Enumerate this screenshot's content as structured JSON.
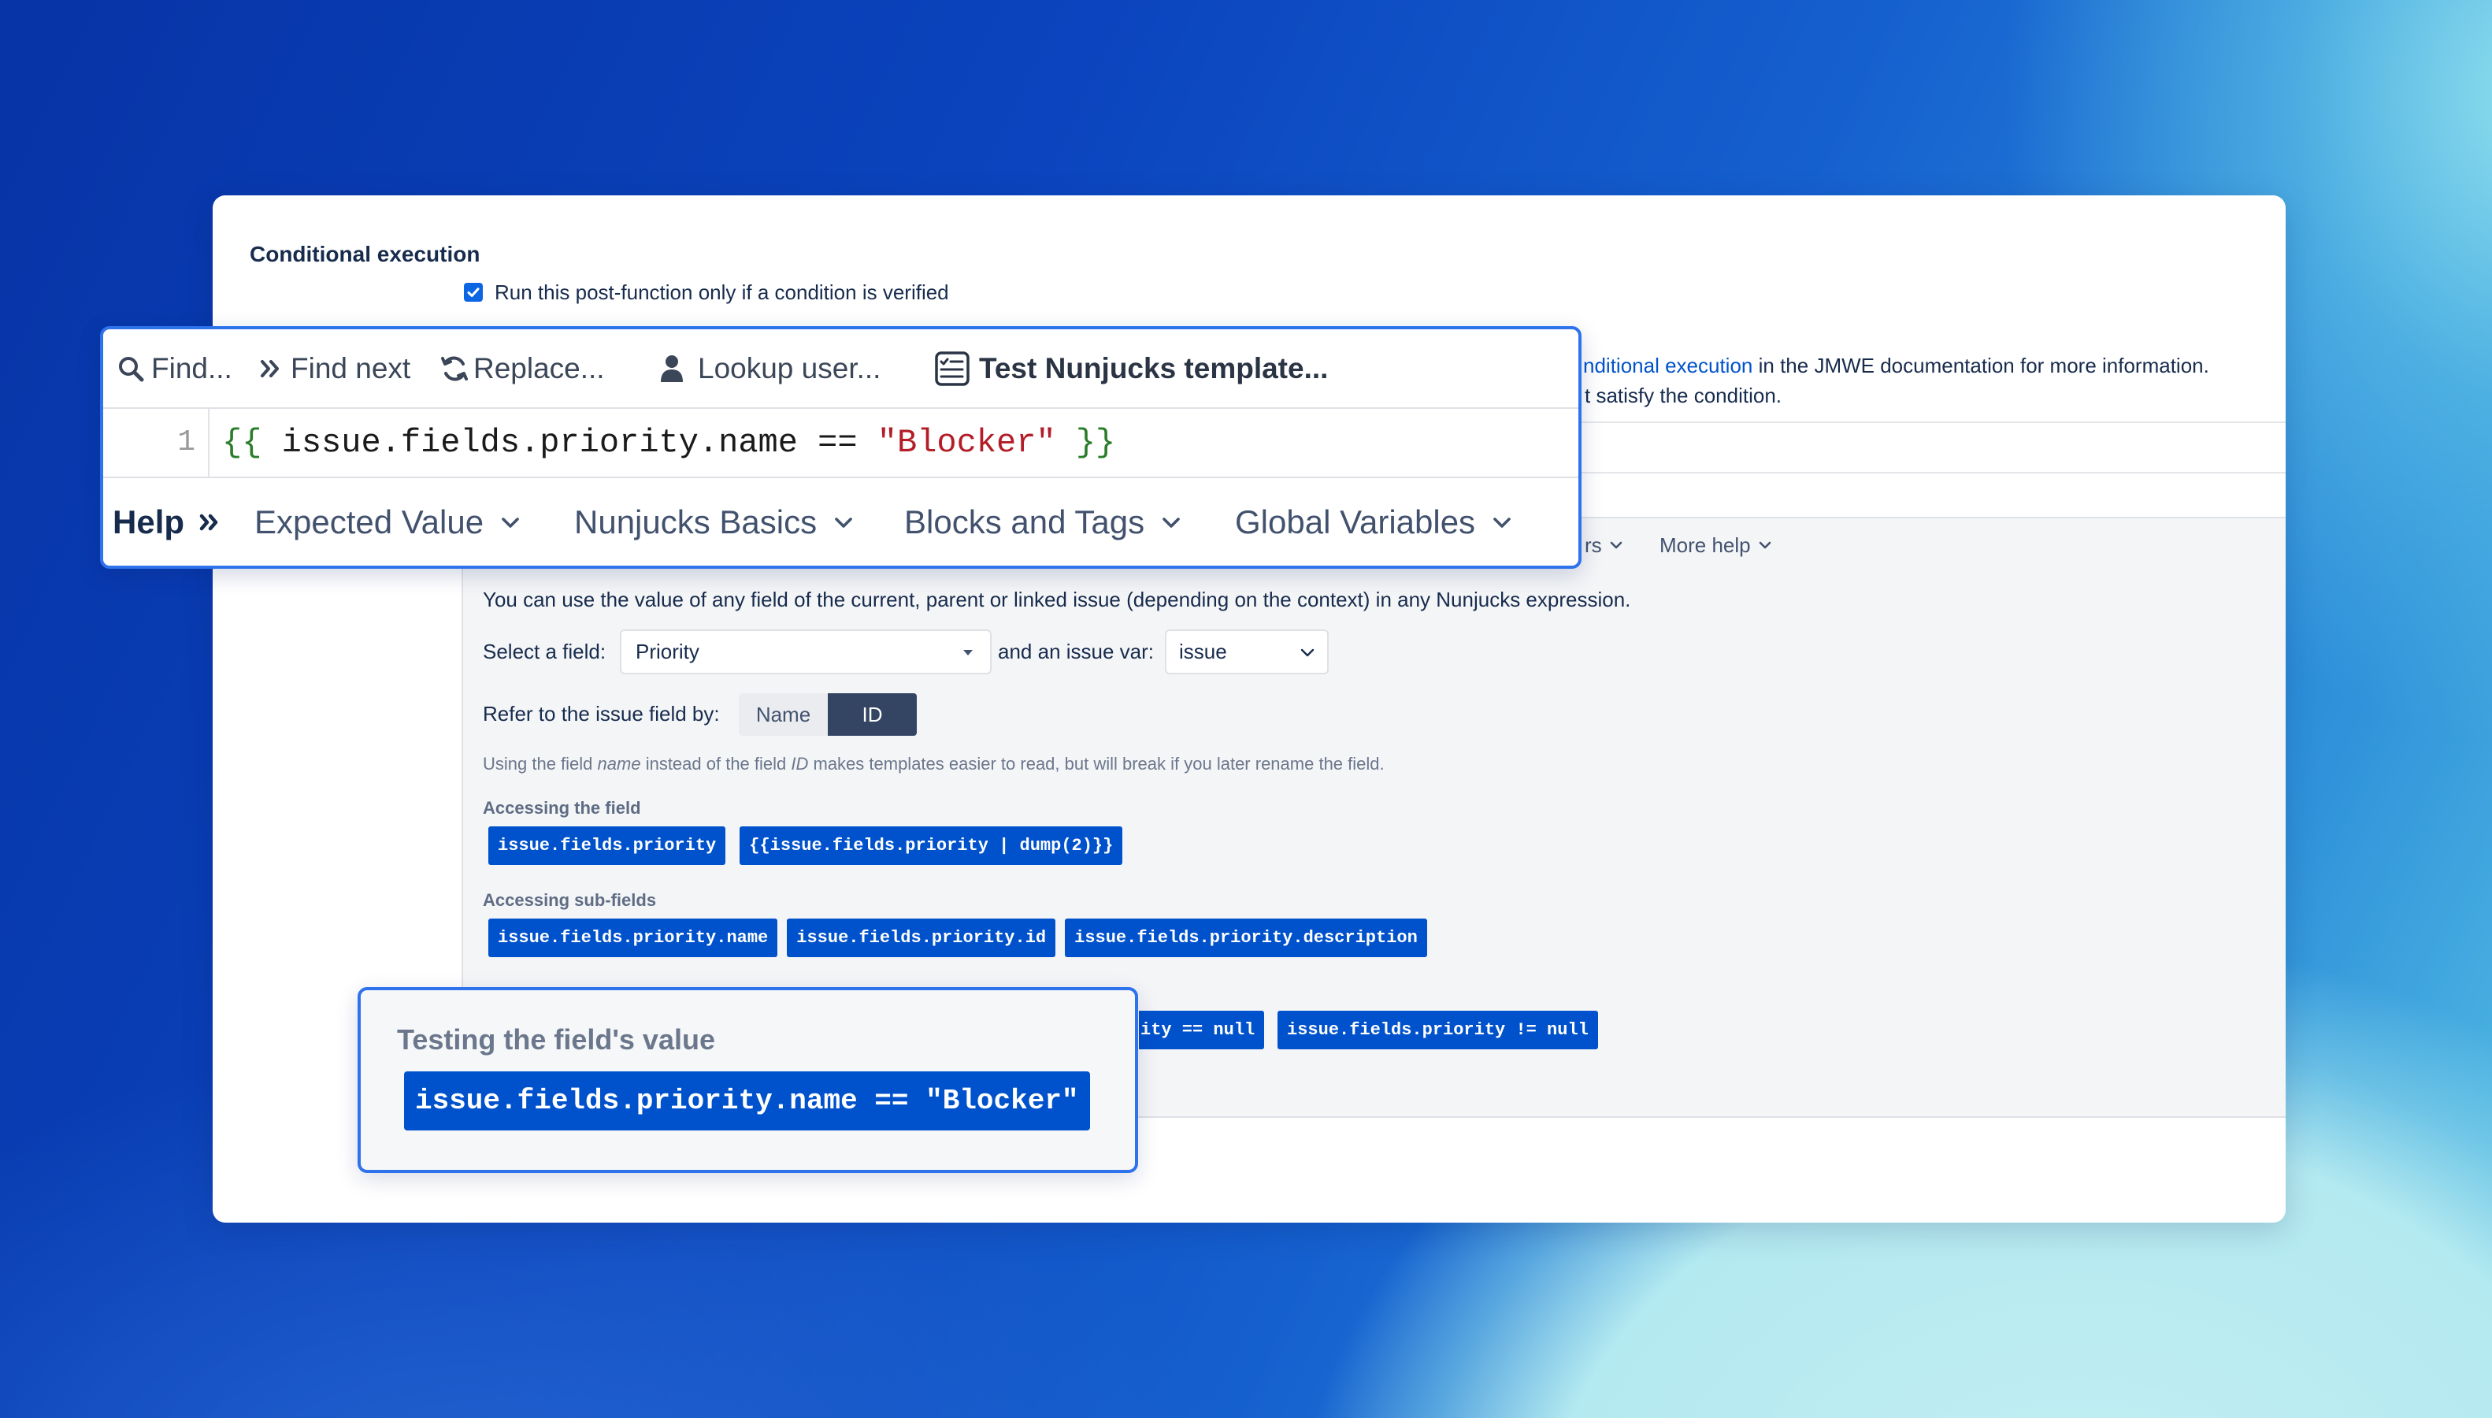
{
  "colors": {
    "accent": "#0052cc",
    "highlight_border": "#2e72ec",
    "selected_toggle": "#344563",
    "code_brace": "#2a7d2a",
    "code_string": "#b31d28"
  },
  "card": {
    "section_title": "Conditional execution",
    "condition_checkbox": {
      "checked": true,
      "label": "Run this post-function only if a condition is verified"
    },
    "doc_line": {
      "link": "nditional execution",
      "rest": " in the JMWE documentation for more information."
    },
    "condition_line": "t satisfy the condition.",
    "help_menus_partial": [
      {
        "label": "rs",
        "icon": "chevron-down-icon"
      },
      {
        "label": "More help",
        "icon": "chevron-down-icon"
      }
    ],
    "field_help": {
      "intro": "You can use the value of any field of the current, parent or linked issue (depending on the context) in any Nunjucks expression.",
      "select_field_label": "Select a field:",
      "select_field_value": "Priority",
      "issue_var_label": "and an issue var:",
      "issue_var_value": "issue",
      "refer_label": "Refer to the issue field by:",
      "refer_options": [
        "Name",
        "ID"
      ],
      "refer_selected": "ID",
      "hint": {
        "p1": "Using the field ",
        "em1": "name",
        "p2": " instead of the field ",
        "em2": "ID",
        "p3": " makes templates easier to read, but will break if you later rename the field."
      },
      "sections": [
        {
          "title": "Accessing the field",
          "snippets": [
            "issue.fields.priority",
            "{{issue.fields.priority | dump(2)}}"
          ]
        },
        {
          "title": "Accessing sub-fields",
          "snippets": [
            "issue.fields.priority.name",
            "issue.fields.priority.id",
            "issue.fields.priority.description"
          ]
        },
        {
          "snippets": [
            "ity == null",
            "issue.fields.priority != null"
          ]
        }
      ]
    }
  },
  "editor": {
    "toolbar": [
      {
        "label": "Find...",
        "icon": "search-icon"
      },
      {
        "label": "Find next",
        "icon": "double-chevron-right-icon"
      },
      {
        "label": "Replace...",
        "icon": "refresh-icon"
      },
      {
        "label": "Lookup user...",
        "icon": "user-icon"
      },
      {
        "label": "Test Nunjucks template...",
        "icon": "checklist-icon"
      }
    ],
    "line_number": "1",
    "code": {
      "open": "{{",
      "expression": "issue.fields.priority.name ==",
      "string": "\"Blocker\"",
      "close": "}}"
    },
    "help_label": "Help",
    "help_menus": [
      "Expected Value",
      "Nunjucks Basics",
      "Blocks and Tags",
      "Global Variables"
    ]
  },
  "callout": {
    "title": "Testing the field's value",
    "snippet": "issue.fields.priority.name == \"Blocker\""
  }
}
